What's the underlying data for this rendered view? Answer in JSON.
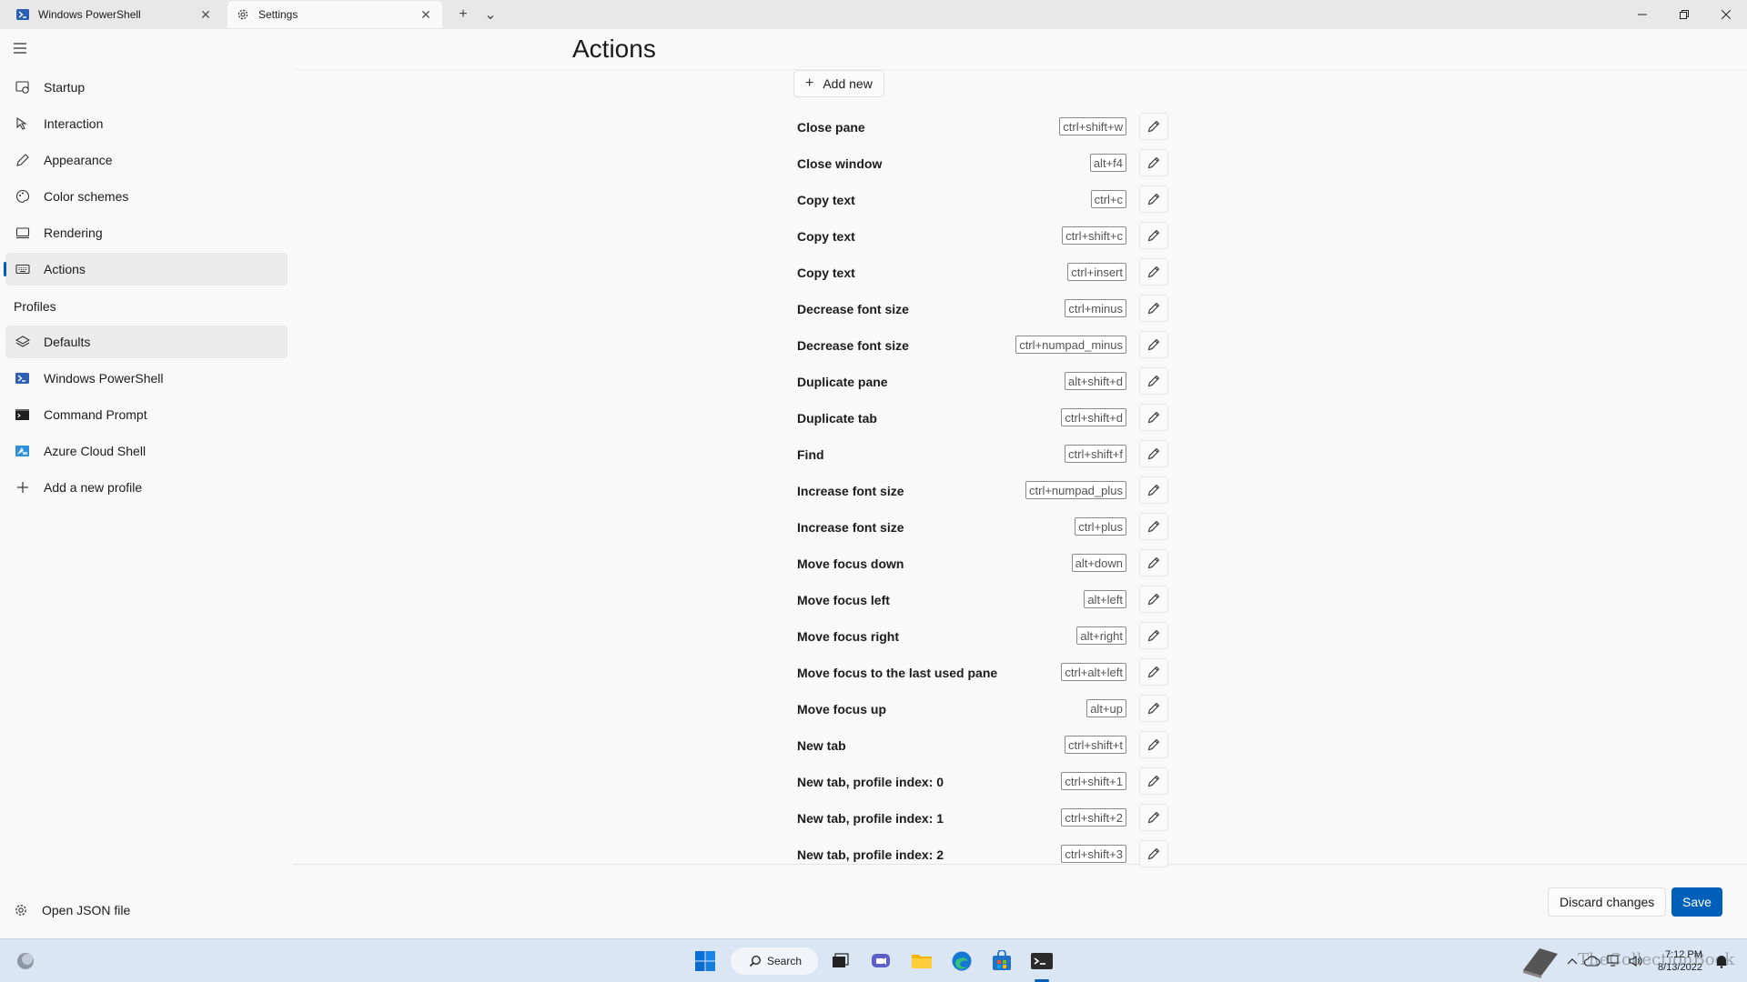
{
  "titlebar": {
    "tabs": [
      {
        "title": "Windows PowerShell",
        "icon": "powershell-icon"
      },
      {
        "title": "Settings",
        "icon": "gear-icon"
      }
    ],
    "new_tab_symbol": "+",
    "dropdown_symbol": "⌄"
  },
  "nav": {
    "items": [
      {
        "label": "Startup",
        "icon": "startup-icon"
      },
      {
        "label": "Interaction",
        "icon": "interaction-icon"
      },
      {
        "label": "Appearance",
        "icon": "pen-icon"
      },
      {
        "label": "Color schemes",
        "icon": "palette-icon"
      },
      {
        "label": "Rendering",
        "icon": "monitor-icon"
      },
      {
        "label": "Actions",
        "icon": "keyboard-icon",
        "selected": true
      }
    ],
    "profiles_header": "Profiles",
    "profiles": [
      {
        "label": "Defaults",
        "icon": "layers-icon",
        "selected": true
      },
      {
        "label": "Windows PowerShell",
        "icon": "powershell-icon"
      },
      {
        "label": "Command Prompt",
        "icon": "cmd-icon"
      },
      {
        "label": "Azure Cloud Shell",
        "icon": "azure-icon"
      },
      {
        "label": "Add a new profile",
        "icon": "plus-icon"
      }
    ],
    "open_json": "Open JSON file"
  },
  "main": {
    "title": "Actions",
    "add_new": "Add new",
    "actions": [
      {
        "name": "Close pane",
        "keys": "ctrl+shift+w"
      },
      {
        "name": "Close window",
        "keys": "alt+f4"
      },
      {
        "name": "Copy text",
        "keys": "ctrl+c"
      },
      {
        "name": "Copy text",
        "keys": "ctrl+shift+c"
      },
      {
        "name": "Copy text",
        "keys": "ctrl+insert"
      },
      {
        "name": "Decrease font size",
        "keys": "ctrl+minus"
      },
      {
        "name": "Decrease font size",
        "keys": "ctrl+numpad_minus"
      },
      {
        "name": "Duplicate pane",
        "keys": "alt+shift+d"
      },
      {
        "name": "Duplicate tab",
        "keys": "ctrl+shift+d"
      },
      {
        "name": "Find",
        "keys": "ctrl+shift+f"
      },
      {
        "name": "Increase font size",
        "keys": "ctrl+numpad_plus"
      },
      {
        "name": "Increase font size",
        "keys": "ctrl+plus"
      },
      {
        "name": "Move focus down",
        "keys": "alt+down"
      },
      {
        "name": "Move focus left",
        "keys": "alt+left"
      },
      {
        "name": "Move focus right",
        "keys": "alt+right"
      },
      {
        "name": "Move focus to the last used pane",
        "keys": "ctrl+alt+left"
      },
      {
        "name": "Move focus up",
        "keys": "alt+up"
      },
      {
        "name": "New tab",
        "keys": "ctrl+shift+t"
      },
      {
        "name": "New tab, profile index: 0",
        "keys": "ctrl+shift+1"
      },
      {
        "name": "New tab, profile index: 1",
        "keys": "ctrl+shift+2"
      },
      {
        "name": "New tab, profile index: 2",
        "keys": "ctrl+shift+3"
      }
    ]
  },
  "footer": {
    "discard": "Discard changes",
    "save": "Save"
  },
  "taskbar": {
    "search_label": "Search",
    "time": "7:12 PM",
    "date": "8/13/2022",
    "watermark": "TheCollectionBook"
  },
  "colors": {
    "accent": "#005fb8",
    "taskbar": "#dbe6f4"
  }
}
